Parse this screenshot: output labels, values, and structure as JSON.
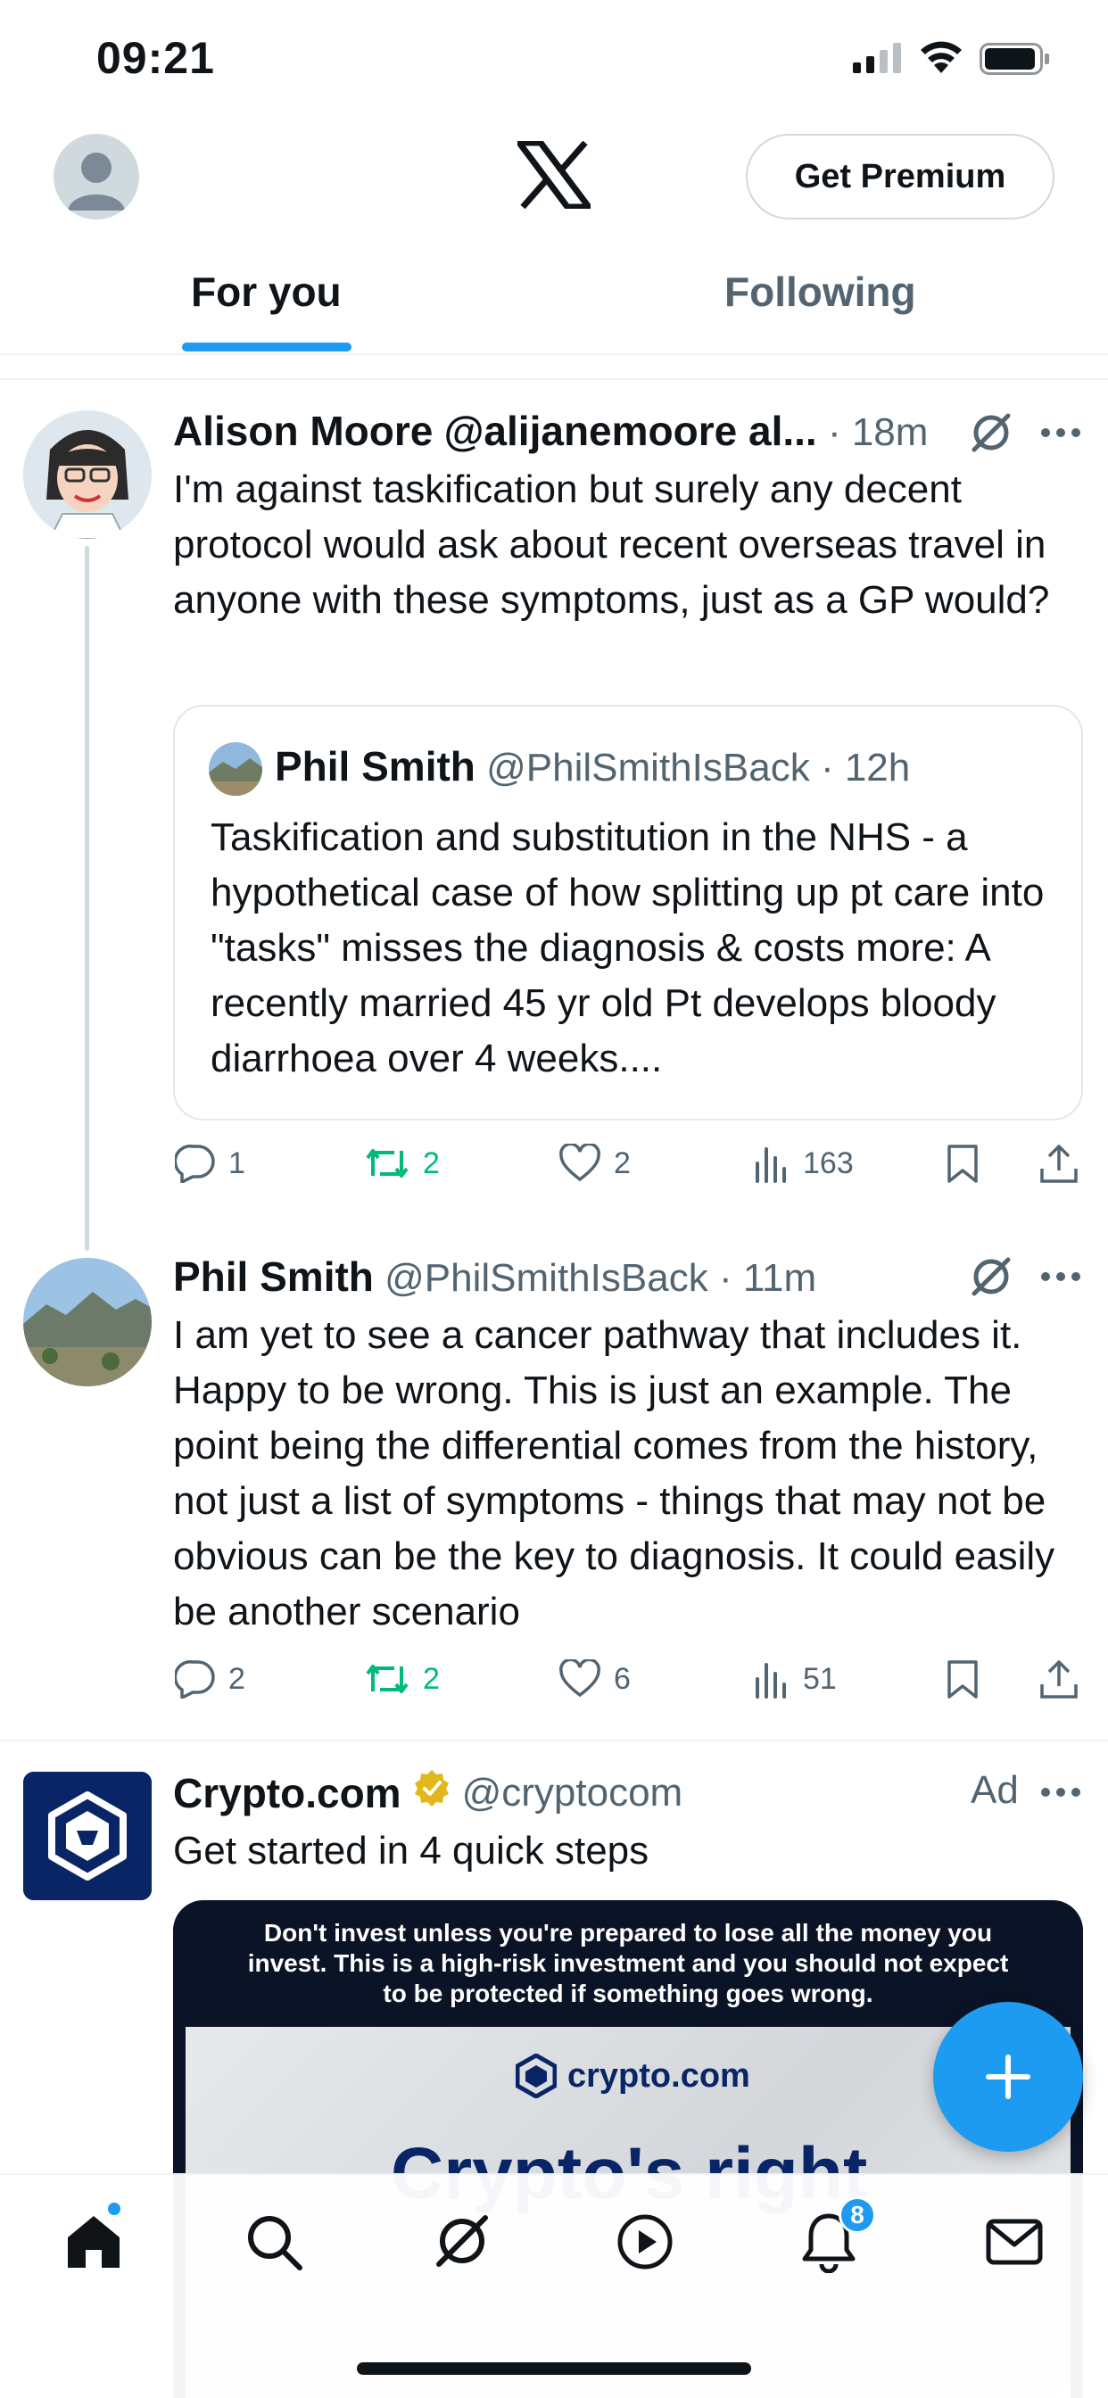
{
  "status_bar": {
    "time": "09:21"
  },
  "header": {
    "premium_label": "Get Premium"
  },
  "tabs": [
    {
      "label": "For you",
      "active": true
    },
    {
      "label": "Following",
      "active": false
    }
  ],
  "posts": [
    {
      "name": "Alison Moore",
      "handle": "@alijanemoore al...",
      "time": "· 18m",
      "text": "I'm against taskification but surely any decent protocol would ask about recent overseas travel in anyone with these symptoms, just as a GP would?",
      "quote": {
        "name": "Phil Smith",
        "handle": "@PhilSmithIsBack",
        "time": "· 12h",
        "text": "Taskification and substitution in the NHS - a hypothetical case of how splitting up pt care into \"tasks\" misses the diagnosis & costs more: A recently married 45 yr old Pt develops bloody diarrhoea over 4 weeks...."
      },
      "replies": "1",
      "reposts": "2",
      "likes": "2",
      "views": "163"
    },
    {
      "name": "Phil Smith",
      "handle": "@PhilSmithIsBack",
      "time": "· 11m",
      "text": "I am yet to see a cancer pathway that includes it. Happy to be wrong. This is just an example. The point being the differential comes from the history, not just a list of symptoms - things that may not be obvious can be the key to diagnosis. It could easily be another scenario",
      "replies": "2",
      "reposts": "2",
      "likes": "6",
      "views": "51"
    }
  ],
  "ad": {
    "name": "Crypto.com",
    "handle": "@cryptocom",
    "ad_label": "Ad",
    "text": "Get started in 4 quick steps",
    "warning": "Don't invest unless you're prepared to lose all the money you invest. This is a high-risk investment and you should not expect to be protected if something goes wrong.",
    "brand": "crypto.com",
    "headline": "Crypto's right"
  },
  "bottom_nav": {
    "notifications_badge": "8"
  },
  "colors": {
    "accent": "#1d9bf0",
    "repost_green": "#00ba7c",
    "muted": "#536471"
  }
}
